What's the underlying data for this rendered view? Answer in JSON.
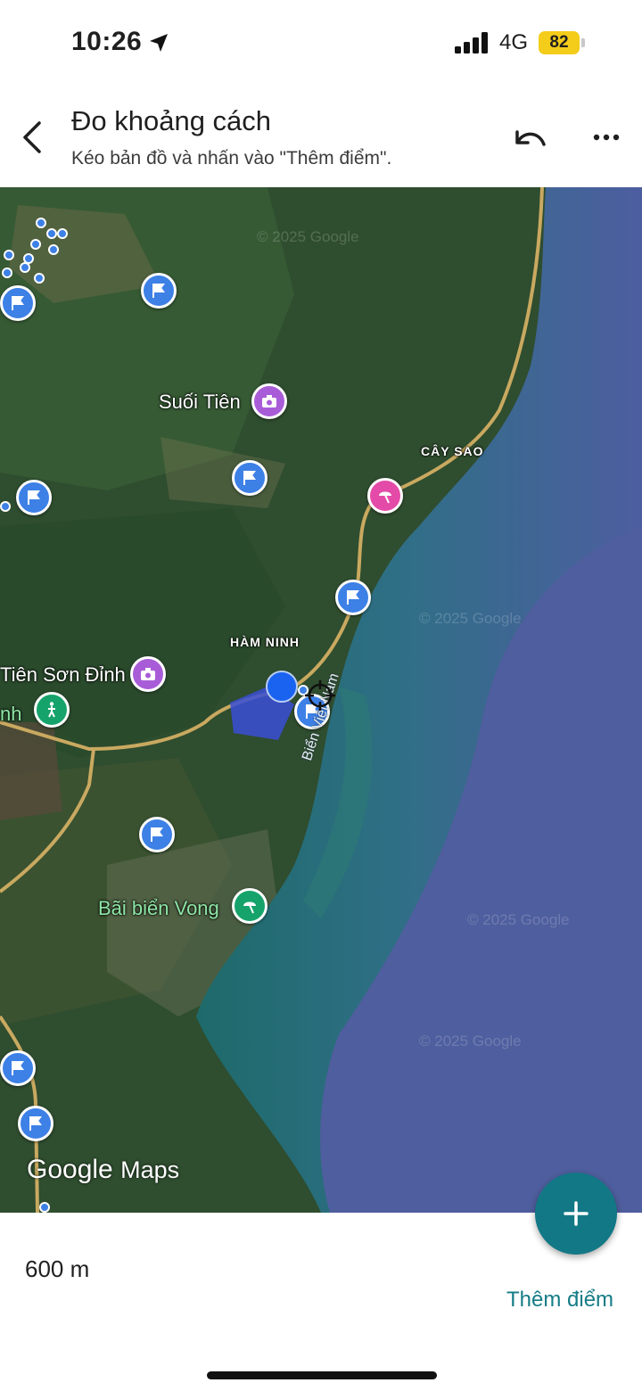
{
  "status_bar": {
    "time": "10:26",
    "network": "4G",
    "battery": "82",
    "icons": [
      "location-arrow-icon",
      "cellular-signal-icon",
      "battery-icon"
    ]
  },
  "header": {
    "title": "Đo khoảng cách",
    "subtitle": "Kéo bản đồ và nhấn vào \"Thêm điểm\".",
    "icons": [
      "back-arrow-icon",
      "undo-icon",
      "more-vertical-icon"
    ]
  },
  "map": {
    "places": {
      "suoi_tien": "Suối Tiên",
      "cay_sao": "CÂY SAO",
      "ham_ninh": "HÀM NINH",
      "tien_son_dinh": "Tiên Sơn Đỉnh",
      "park_partial": "nh",
      "bai_bien_vong": "Bãi biển Vong",
      "sea": "Biển Việt Nam"
    },
    "watermark": "© 2025 Google",
    "logo": {
      "google": "Google",
      "maps": "Maps"
    },
    "pin_types": [
      "flag-icon",
      "camera-icon",
      "beach-umbrella-icon",
      "hiking-icon",
      "my-location-dot",
      "crosshair-icon"
    ],
    "colors": {
      "pin_blue": "#3d80e6",
      "pin_purple": "#a95cd8",
      "pin_pink": "#e44ba8",
      "pin_green": "#16a36b",
      "sea": "#4a5e9c"
    }
  },
  "panel": {
    "distance": "600 m",
    "add_point_label": "Thêm điểm",
    "accent": "#137886"
  }
}
